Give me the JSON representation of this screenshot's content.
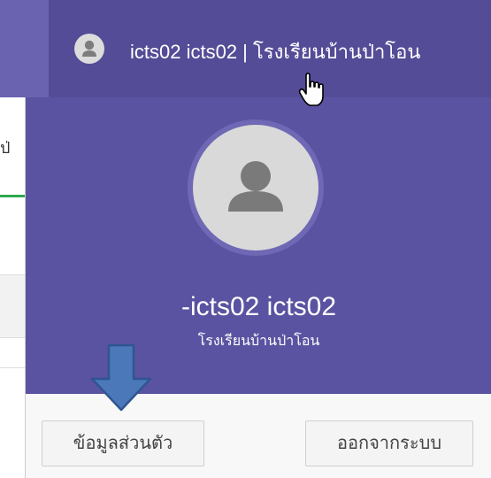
{
  "navbar": {
    "user_text": "icts02 icts02 | โรงเรียนบ้านป่าโอน"
  },
  "background_page": {
    "fragment_text": "ป่"
  },
  "dropdown": {
    "header": {
      "name": "-icts02 icts02",
      "school": "โรงเรียนบ้านป่าโอน"
    },
    "footer": {
      "profile_label": "ข้อมูลส่วนตัว",
      "logout_label": "ออกจากระบบ"
    }
  },
  "colors": {
    "navbar": "#5a53a1",
    "header": "#5a53a1",
    "avatar": "#d9d9d9",
    "annotation_arrow": "#4a78b9"
  },
  "icons": {
    "nav_avatar": "user-silhouette-icon",
    "big_avatar": "user-silhouette-icon",
    "cursor": "hand-pointer-cursor",
    "annotation": "down-arrow"
  }
}
